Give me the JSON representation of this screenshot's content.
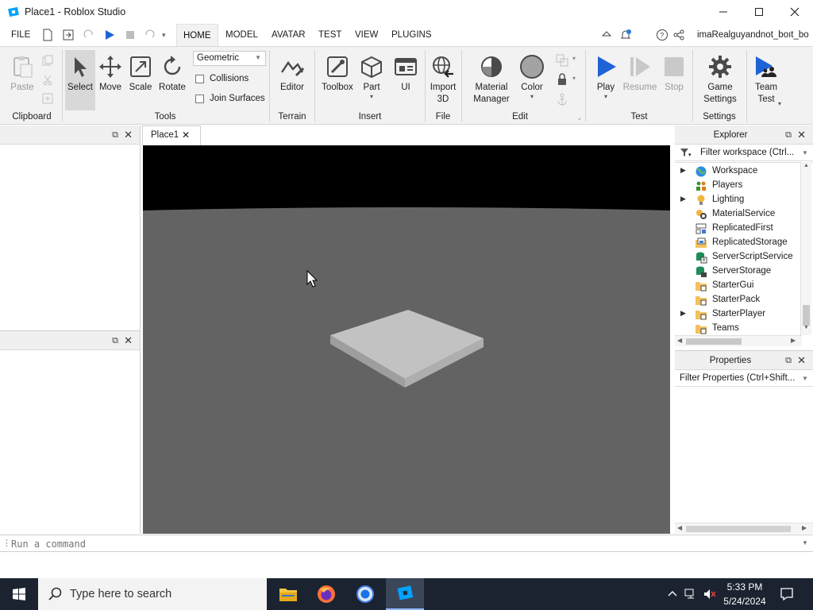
{
  "window": {
    "title": "Place1 - Roblox Studio"
  },
  "menu": {
    "file": "FILE",
    "tabs": [
      "HOME",
      "MODEL",
      "AVATAR",
      "TEST",
      "VIEW",
      "PLUGINS"
    ],
    "username": "imaRealguyandnot_boıt_bo"
  },
  "ribbon": {
    "clipboard": {
      "paste": "Paste",
      "label": "Clipboard"
    },
    "tools": {
      "select": "Select",
      "move": "Move",
      "scale": "Scale",
      "rotate": "Rotate",
      "label": "Tools",
      "mode": "Geometric",
      "collisions": "Collisions",
      "join_surfaces": "Join Surfaces"
    },
    "terrain": {
      "editor": "Editor",
      "label": "Terrain"
    },
    "insert": {
      "toolbox": "Toolbox",
      "part": "Part",
      "ui": "UI",
      "label": "Insert"
    },
    "file": {
      "import3d_line1": "Import",
      "import3d_line2": "3D",
      "label": "File"
    },
    "edit": {
      "material_line1": "Material",
      "material_line2": "Manager",
      "color": "Color",
      "label": "Edit"
    },
    "test": {
      "play": "Play",
      "resume": "Resume",
      "stop": "Stop",
      "label": "Test"
    },
    "settings": {
      "game_line1": "Game",
      "game_line2": "Settings",
      "label": "Settings"
    },
    "team": {
      "line1": "Team",
      "line2": "Test"
    }
  },
  "document_tab": {
    "label": "Place1"
  },
  "explorer": {
    "title": "Explorer",
    "filter_placeholder": "Filter workspace (Ctrl...",
    "items": [
      {
        "label": "Workspace",
        "expandable": true,
        "icon": "globe-icon"
      },
      {
        "label": "Players",
        "expandable": false,
        "icon": "players-icon"
      },
      {
        "label": "Lighting",
        "expandable": true,
        "icon": "lightbulb-icon"
      },
      {
        "label": "MaterialService",
        "expandable": false,
        "icon": "material-service-icon"
      },
      {
        "label": "ReplicatedFirst",
        "expandable": false,
        "icon": "replicated-first-icon"
      },
      {
        "label": "ReplicatedStorage",
        "expandable": false,
        "icon": "replicated-storage-icon"
      },
      {
        "label": "ServerScriptService",
        "expandable": false,
        "icon": "server-script-icon"
      },
      {
        "label": "ServerStorage",
        "expandable": false,
        "icon": "server-storage-icon"
      },
      {
        "label": "StarterGui",
        "expandable": false,
        "icon": "folder-icon"
      },
      {
        "label": "StarterPack",
        "expandable": false,
        "icon": "folder-icon"
      },
      {
        "label": "StarterPlayer",
        "expandable": true,
        "icon": "folder-icon"
      },
      {
        "label": "Teams",
        "expandable": false,
        "icon": "folder-icon"
      }
    ]
  },
  "properties": {
    "title": "Properties",
    "filter_placeholder": "Filter Properties (Ctrl+Shift..."
  },
  "command_bar": {
    "placeholder": "Run a command"
  },
  "taskbar": {
    "search_placeholder": "Type here to search",
    "time": "5:33 PM",
    "date": "5/24/2024"
  },
  "colors": {
    "accent": "#0067c5",
    "viewport_ground": "#636363",
    "sky": "#000000",
    "taskbar": "#1b2330"
  }
}
